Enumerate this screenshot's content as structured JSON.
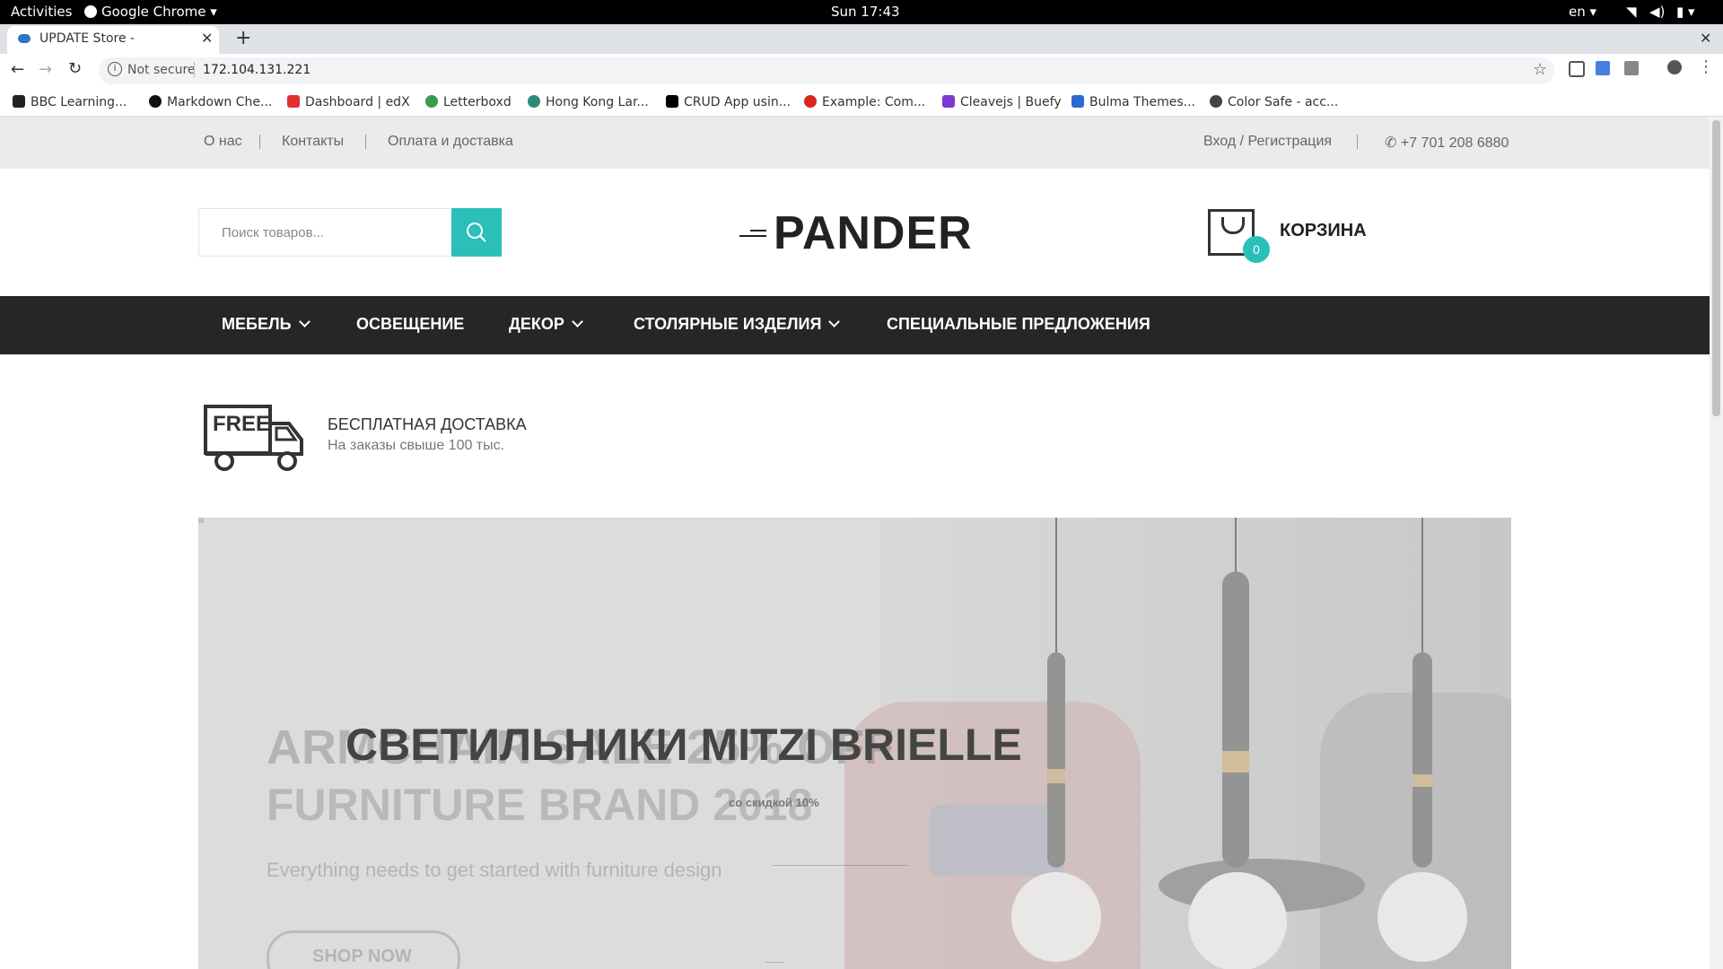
{
  "gnome": {
    "activities": "Activities",
    "app": "Google Chrome",
    "clock": "Sun 17:43",
    "lang": "en"
  },
  "browser": {
    "tab_title": "UPDATE Store -",
    "not_secure": "Not secure",
    "url": "172.104.131.221",
    "bookmarks": [
      "BBC Learning...",
      "Markdown Che...",
      "Dashboard | edX",
      "Letterboxd",
      "Hong Kong Lar...",
      "CRUD App usin...",
      "Example: Com...",
      "Cleavejs | Buefy",
      "Bulma Themes...",
      "Color Safe - acc..."
    ]
  },
  "topbar": {
    "links": [
      "О нас",
      "Контакты",
      "Оплата и доставка"
    ],
    "login": "Вход / Регистрация",
    "phone": "+7 701 208 6880"
  },
  "header": {
    "search_placeholder": "Поиск товаров...",
    "logo": "PANDER",
    "cart_count": "0",
    "cart_label": "КОРЗИНА"
  },
  "nav": [
    "МЕБЕЛЬ",
    "ОСВЕЩЕНИЕ",
    "ДЕКОР",
    "СТОЛЯРНЫЕ ИЗДЕЛИЯ",
    "СПЕЦИАЛЬНЫЕ ПРЕДЛОЖЕНИЯ"
  ],
  "promo": {
    "badge": "FREE",
    "title": "БЕСПЛАТНАЯ ДОСТАВКА",
    "subtitle": "На заказы свыше 100 тыс."
  },
  "hero": {
    "bg_title_1": "ARMCHAIR SALE 25% OFF",
    "bg_title_2": "FURNITURE BRAND 2018",
    "bg_subtitle": "Everything needs to get started with furniture design",
    "bg_button": "SHOP NOW",
    "title": "СВЕТИЛЬНИКИ MITZI BRIELLE",
    "discount": "со скидкой 10%"
  },
  "colors": {
    "accent": "#2bbfb9",
    "nav_bg": "#262626",
    "topbar_bg": "#ebebeb"
  }
}
